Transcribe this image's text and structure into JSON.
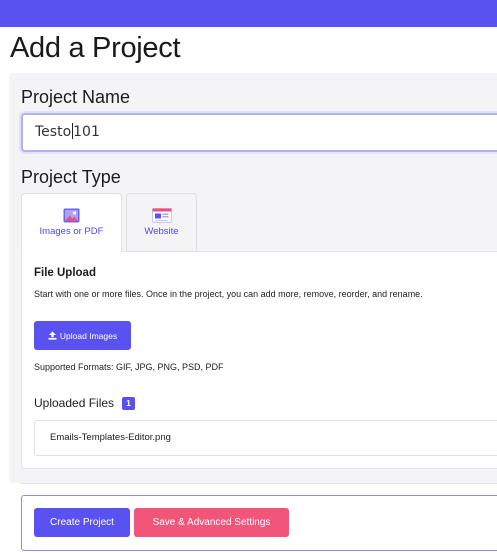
{
  "page": {
    "title": "Add a Project"
  },
  "project_name": {
    "label": "Project Name",
    "value_before_caret": "Testo",
    "value_after_caret": "101"
  },
  "project_type": {
    "label": "Project Type",
    "tabs": [
      {
        "label": "Images or PDF",
        "icon": "image-icon",
        "active": true
      },
      {
        "label": "Website",
        "icon": "browser-window-icon",
        "active": false
      }
    ]
  },
  "file_upload": {
    "title": "File Upload",
    "description": "Start with one or more files. Once in the project, you can add more, remove, reorder, and rename.",
    "upload_button": "Upload Images",
    "upload_icon": "upload-arrow-icon",
    "supported_formats": "Supported Formats: GIF, JPG, PNG, PSD, PDF",
    "uploaded_files_label": "Uploaded Files",
    "uploaded_count": "1",
    "files": [
      "Emails-Templates-Editor.png"
    ]
  },
  "actions": {
    "create": "Create Project",
    "save_advanced": "Save & Advanced Settings"
  },
  "colors": {
    "accent": "#5a52f0",
    "danger": "#f2557a"
  }
}
